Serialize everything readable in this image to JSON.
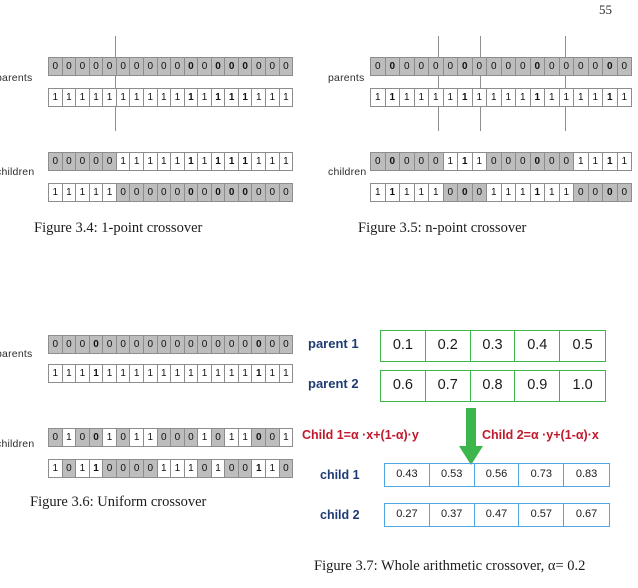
{
  "page": {
    "number": "55"
  },
  "figures": {
    "fig34": {
      "caption": "Figure 3.4: 1-point crossover",
      "labels": {
        "parents": "parents",
        "children": "children"
      },
      "length": 18,
      "crossover_points": [
        5
      ],
      "parent1": [
        "0",
        "0",
        "0",
        "0",
        "0",
        "0",
        "0",
        "0",
        "0",
        "0",
        "0",
        "0",
        "0",
        "0",
        "0",
        "0",
        "0",
        "0"
      ],
      "parent2": [
        "1",
        "1",
        "1",
        "1",
        "1",
        "1",
        "1",
        "1",
        "1",
        "1",
        "1",
        "1",
        "1",
        "1",
        "1",
        "1",
        "1",
        "1"
      ],
      "child1": [
        "0",
        "0",
        "0",
        "0",
        "0",
        "1",
        "1",
        "1",
        "1",
        "1",
        "1",
        "1",
        "1",
        "1",
        "1",
        "1",
        "1",
        "1"
      ],
      "child2": [
        "1",
        "1",
        "1",
        "1",
        "1",
        "0",
        "0",
        "0",
        "0",
        "0",
        "0",
        "0",
        "0",
        "0",
        "0",
        "0",
        "0",
        "0"
      ]
    },
    "fig35": {
      "caption": "Figure 3.5: n-point crossover",
      "labels": {
        "parents": "parents",
        "children": "children"
      },
      "length": 18,
      "crossover_points": [
        5,
        8,
        14
      ],
      "parent1": [
        "0",
        "0",
        "0",
        "0",
        "0",
        "0",
        "0",
        "0",
        "0",
        "0",
        "0",
        "0",
        "0",
        "0",
        "0",
        "0",
        "0",
        "0"
      ],
      "parent2": [
        "1",
        "1",
        "1",
        "1",
        "1",
        "1",
        "1",
        "1",
        "1",
        "1",
        "1",
        "1",
        "1",
        "1",
        "1",
        "1",
        "1",
        "1"
      ],
      "child1": [
        "0",
        "0",
        "0",
        "0",
        "0",
        "1",
        "1",
        "1",
        "0",
        "0",
        "0",
        "0",
        "0",
        "0",
        "1",
        "1",
        "1",
        "1"
      ],
      "child2": [
        "1",
        "1",
        "1",
        "1",
        "1",
        "0",
        "0",
        "0",
        "1",
        "1",
        "1",
        "1",
        "1",
        "1",
        "0",
        "0",
        "0",
        "0"
      ]
    },
    "fig36": {
      "caption": "Figure 3.6: Uniform crossover",
      "labels": {
        "parents": "parents",
        "children": "children"
      },
      "length": 18,
      "parent1": [
        "0",
        "0",
        "0",
        "0",
        "0",
        "0",
        "0",
        "0",
        "0",
        "0",
        "0",
        "0",
        "0",
        "0",
        "0",
        "0",
        "0",
        "0"
      ],
      "parent2": [
        "1",
        "1",
        "1",
        "1",
        "1",
        "1",
        "1",
        "1",
        "1",
        "1",
        "1",
        "1",
        "1",
        "1",
        "1",
        "1",
        "1",
        "1"
      ],
      "child1": [
        "0",
        "1",
        "0",
        "0",
        "1",
        "0",
        "1",
        "1",
        "0",
        "0",
        "0",
        "1",
        "0",
        "1",
        "1",
        "0",
        "0",
        "1"
      ],
      "child2": [
        "1",
        "0",
        "1",
        "1",
        "0",
        "0",
        "0",
        "0",
        "1",
        "1",
        "1",
        "0",
        "1",
        "0",
        "0",
        "1",
        "1",
        "0"
      ]
    },
    "fig37": {
      "caption": "Figure 3.7: Whole arithmetic crossover, α= 0.2",
      "labels": {
        "parent1": "parent 1",
        "parent2": "parent 2",
        "child1": "child 1",
        "child2": "child 2"
      },
      "formula_left": "Child 1=α ·x+(1-α)·y",
      "formula_right": "Child 2=α ·y+(1-α)·x",
      "parent1_values": [
        "0.1",
        "0.2",
        "0.3",
        "0.4",
        "0.5"
      ],
      "parent2_values": [
        "0.6",
        "0.7",
        "0.8",
        "0.9",
        "1.0"
      ],
      "child1_values": [
        "0.43",
        "0.53",
        "0.56",
        "0.73",
        "0.83"
      ],
      "child2_values": [
        "0.27",
        "0.37",
        "0.47",
        "0.57",
        "0.67"
      ],
      "colors": {
        "parent_border": "#3cb54a",
        "child_border": "#4ea7e0",
        "label": "#1f3b73",
        "formula": "#c0192b",
        "arrow": "#3cb54a"
      }
    }
  }
}
